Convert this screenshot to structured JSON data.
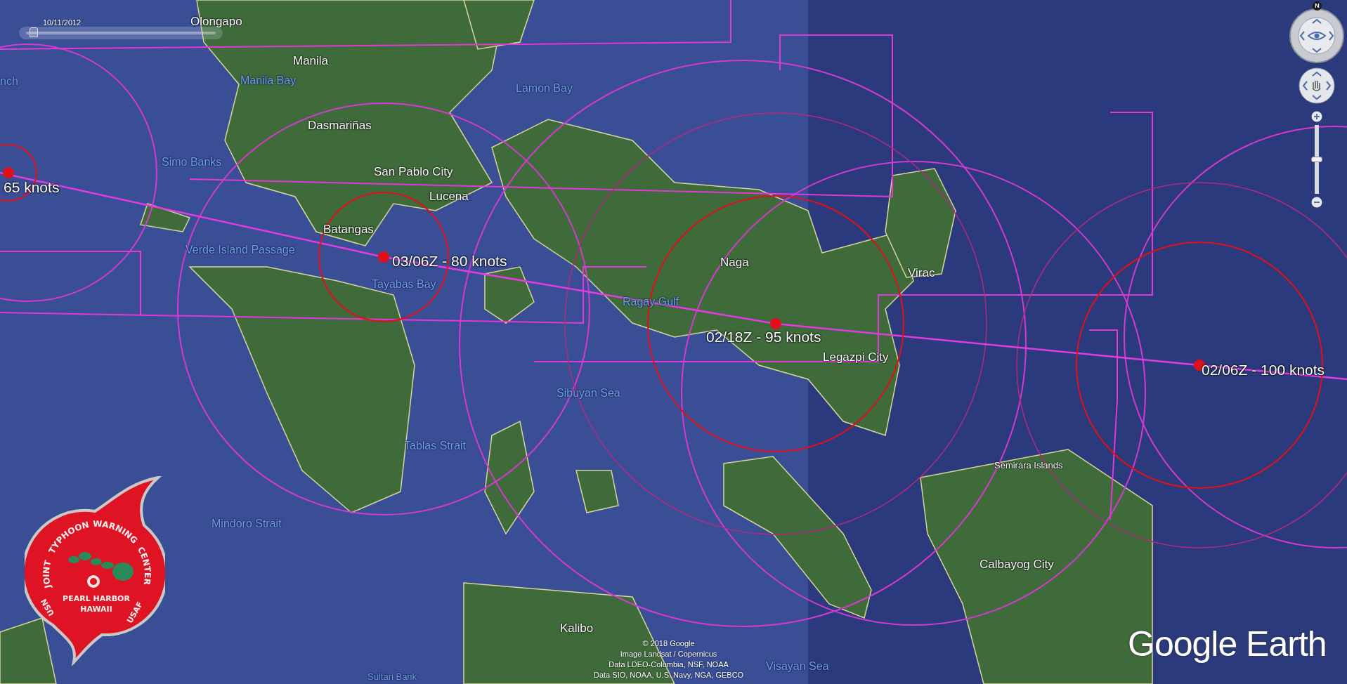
{
  "time_slider": {
    "date": "10/11/2012",
    "level": 0.04
  },
  "place_labels": [
    {
      "text": "Olongapo",
      "kind": "land"
    },
    {
      "text": "nch",
      "kind": "water"
    },
    {
      "text": "Manila",
      "kind": "land"
    },
    {
      "text": "Manila Bay",
      "kind": "water"
    },
    {
      "text": "Lamon Bay",
      "kind": "water"
    },
    {
      "text": "Dasmariñas",
      "kind": "land"
    },
    {
      "text": "Simo Banks",
      "kind": "water"
    },
    {
      "text": "San Pablo City",
      "kind": "land"
    },
    {
      "text": "Lucena",
      "kind": "land"
    },
    {
      "text": "Batangas",
      "kind": "land"
    },
    {
      "text": "Verde Island Passage",
      "kind": "water"
    },
    {
      "text": "Naga",
      "kind": "land"
    },
    {
      "text": "Virac",
      "kind": "land"
    },
    {
      "text": "Tayabas Bay",
      "kind": "water"
    },
    {
      "text": "Ragay Gulf",
      "kind": "water"
    },
    {
      "text": "Legazpi City",
      "kind": "land"
    },
    {
      "text": "Sibuyan Sea",
      "kind": "water"
    },
    {
      "text": "Tablas Strait",
      "kind": "water"
    },
    {
      "text": "Semirara Islands",
      "kind": "land"
    },
    {
      "text": "Mindoro Strait",
      "kind": "water"
    },
    {
      "text": "Calbayog City",
      "kind": "land"
    },
    {
      "text": "Kalibo",
      "kind": "land"
    },
    {
      "text": "Visayan Sea",
      "kind": "water"
    },
    {
      "text": "Sultan Bank",
      "kind": "water"
    }
  ],
  "storm_track": [
    {
      "label": "65 knots"
    },
    {
      "label": "03/06Z - 80 knots"
    },
    {
      "label": "02/18Z - 95 knots"
    },
    {
      "label": "02/06Z - 100 knots"
    }
  ],
  "navigation": {
    "north": "N",
    "zoom_slider": {
      "level": 0.5
    }
  },
  "emblem": {
    "arc_words": [
      "JOINT",
      "TYPHOON",
      "WARNING",
      "CENTER"
    ],
    "center_lines": [
      "PEARL HARBOR",
      "HAWAII"
    ],
    "left_text": "USN",
    "right_text": "USAF"
  },
  "attribution": [
    "© 2018 Google",
    "Image Landsat / Copernicus",
    "Data LDEO-Columbia, NSF, NOAA",
    "Data SIO, NOAA, U.S. Navy, NGA, GEBCO"
  ],
  "logo": "Google Earth"
}
